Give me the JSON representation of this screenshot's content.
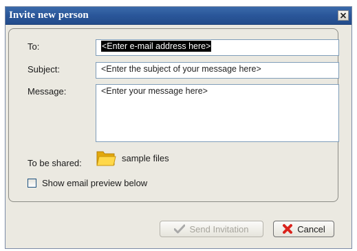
{
  "window": {
    "title": "Invite new person"
  },
  "form": {
    "to_label": "To:",
    "to_value": "<Enter e-mail address here>",
    "subject_label": "Subject:",
    "subject_value": "<Enter the subject of your message here>",
    "message_label": "Message:",
    "message_value": "<Enter your message here>",
    "shared_label": "To be shared:",
    "shared_item": "sample files",
    "preview_checkbox_label": "Show email preview below",
    "preview_checked": false
  },
  "buttons": {
    "send_label": "Send Invitation",
    "send_enabled": false,
    "cancel_label": "Cancel"
  },
  "icons": {
    "close": "close-icon",
    "folder": "folder-icon",
    "send": "checkmark-icon",
    "cancel": "red-x-icon"
  },
  "colors": {
    "titlebar": "#2a5699",
    "dialog_bg": "#ebe9e1",
    "input_border": "#7f9db9",
    "cancel_icon": "#d9231c",
    "send_icon_disabled": "#a9a9a9",
    "folder": "#f5c518"
  }
}
